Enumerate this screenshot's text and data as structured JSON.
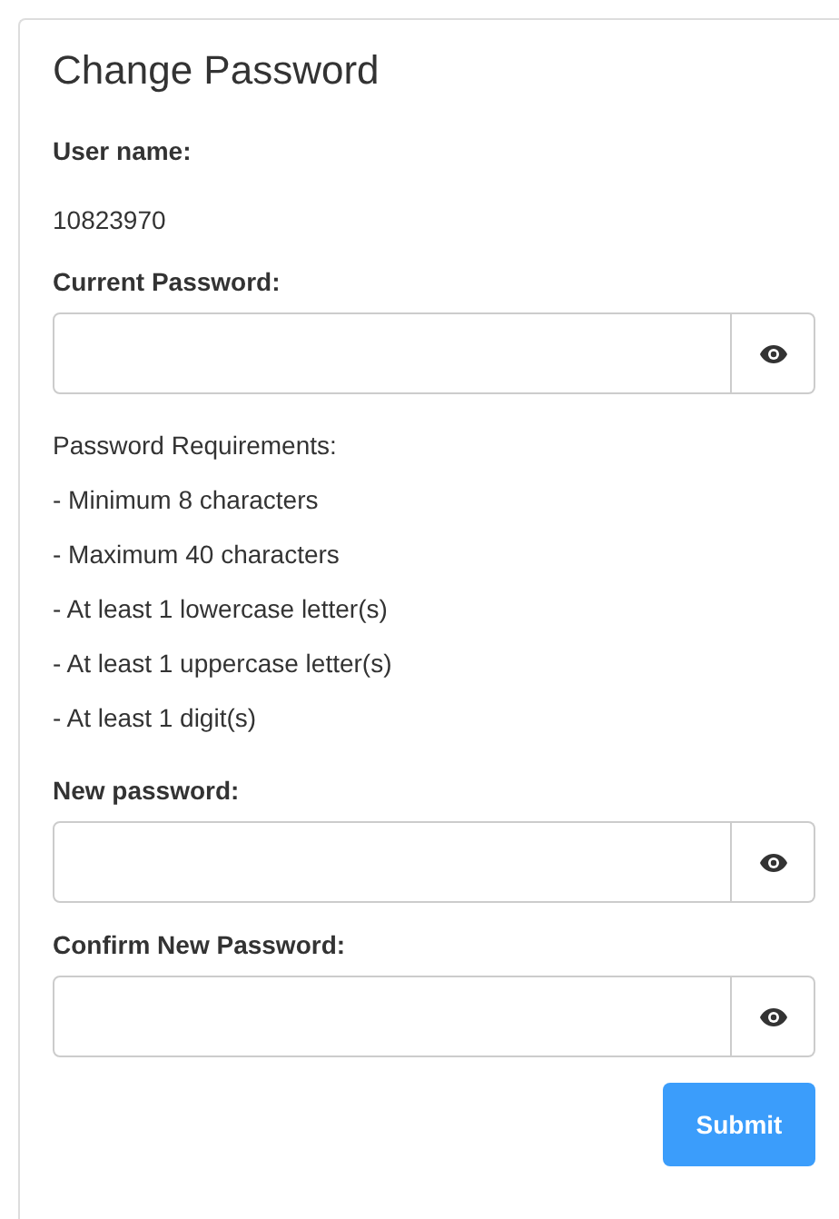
{
  "title": "Change Password",
  "user_name": {
    "label": "User name:",
    "value": "10823970"
  },
  "current_password": {
    "label": "Current Password:"
  },
  "requirements": {
    "heading": "Password Requirements:",
    "items": [
      "- Minimum 8 characters",
      "- Maximum 40 characters",
      "- At least 1 lowercase letter(s)",
      "- At least 1 uppercase letter(s)",
      "- At least 1 digit(s)"
    ]
  },
  "new_password": {
    "label": "New password:"
  },
  "confirm_password": {
    "label": "Confirm New Password:"
  },
  "submit_button": "Submit"
}
